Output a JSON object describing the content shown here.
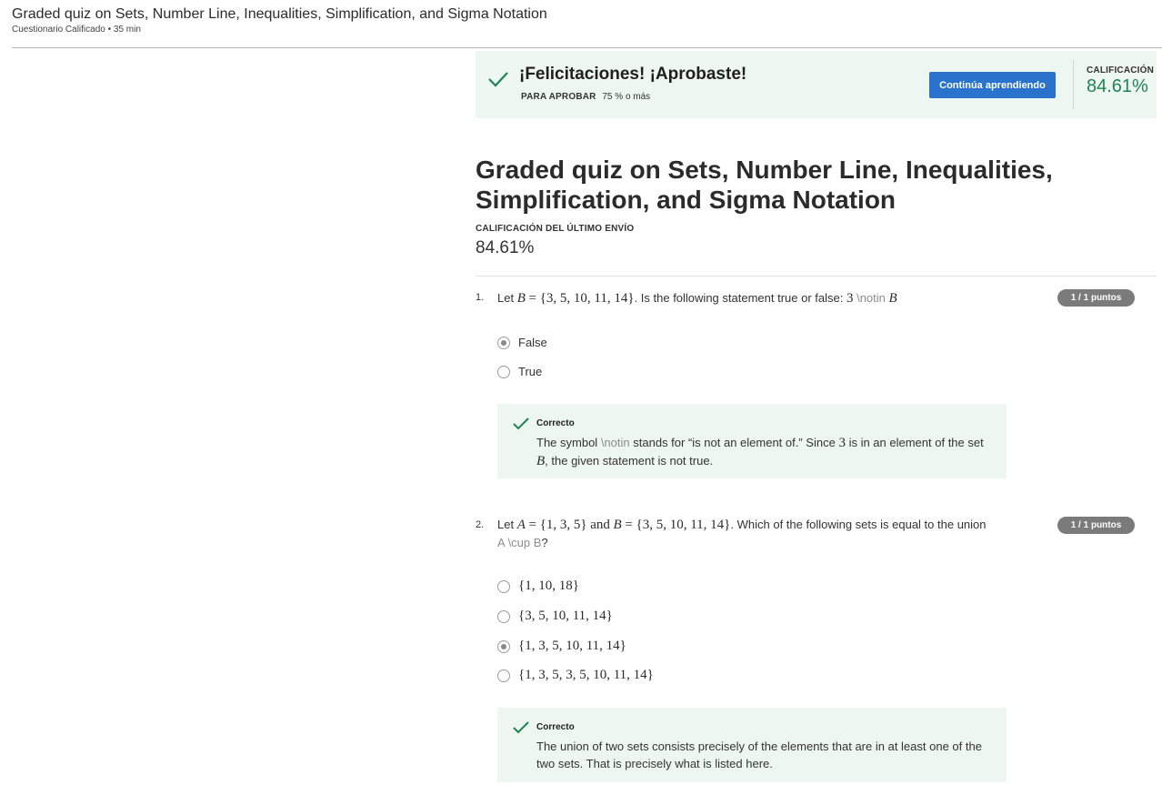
{
  "header": {
    "title": "Graded quiz on Sets, Number Line, Inequalities, Simplification, and Sigma Notation",
    "subtitle": "Cuestionario Calificado • 35 min"
  },
  "banner": {
    "title": "¡Felicitaciones! ¡Aprobaste!",
    "pass_label": "PARA APROBAR",
    "pass_value": "75 % o más",
    "continue_label": "Continúa aprendiendo",
    "grade_label": "CALIFICACIÓN",
    "grade_value": "84.61%",
    "colors": {
      "background": "#eef6f1",
      "accent": "#1f8354",
      "button": "#2a73cc"
    }
  },
  "main": {
    "title": "Graded quiz on Sets, Number Line, Inequalities, Simplification, and Sigma Notation",
    "last_label": "CALIFICACIÓN DEL ÚLTIMO ENVÍO",
    "last_value": "84.61%"
  },
  "questions": [
    {
      "number": "1.",
      "text_prefix": "Let",
      "set_b_name": "B",
      "set_b_value": "= {3, 5, 10, 11, 14}",
      "text_middle": ". Is the following statement true or false:",
      "stmt_value": "3",
      "stmt_op": "\\notin",
      "stmt_set": "B",
      "points": "1 / 1 puntos",
      "options": [
        {
          "label": "False",
          "selected": true
        },
        {
          "label": "True",
          "selected": false
        }
      ],
      "feedback": {
        "label": "Correcto",
        "text_1": "The symbol",
        "symbol": "\\notin",
        "text_2": "stands for “is not an element of.” Since",
        "value": "3",
        "text_3": "is in an element of the set",
        "set": "B",
        "text_4": ", the given statement is not true."
      }
    },
    {
      "number": "2.",
      "text_prefix": "Let",
      "set_a_name": "A",
      "set_a_value": "= {1, 3, 5}",
      "and_word": "and",
      "set_b_name": "B",
      "set_b_value": "= {3, 5, 10, 11, 14}",
      "text_middle": ". Which of the following sets is equal to the union",
      "union_expr": "A \\cup B",
      "text_end": "?",
      "points": "1 / 1 puntos",
      "options": [
        {
          "label": "{1, 10, 18}",
          "selected": false
        },
        {
          "label": "{3, 5, 10, 11, 14}",
          "selected": false
        },
        {
          "label": "{1, 3, 5, 10, 11, 14}",
          "selected": true
        },
        {
          "label": "{1, 3, 5, 3, 5, 10, 11, 14}",
          "selected": false
        }
      ],
      "feedback": {
        "label": "Correcto",
        "text": "The union of two sets consists precisely of the elements that are in at least one of the two sets. That is precisely what is listed here."
      }
    }
  ]
}
